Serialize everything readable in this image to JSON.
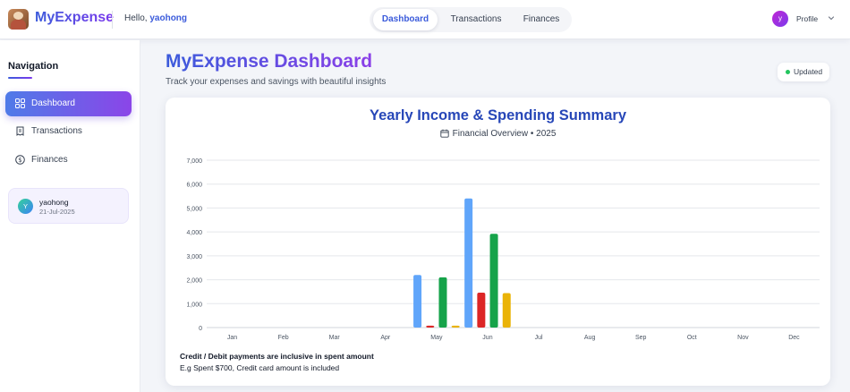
{
  "header": {
    "app_title": "MyExpense",
    "greeting": "Hello,",
    "username": "yaohong",
    "tabs": [
      "Dashboard",
      "Transactions",
      "Finances"
    ],
    "active_tab": "Dashboard",
    "profile_initial": "y",
    "profile_label": "Profile"
  },
  "sidebar": {
    "title": "Navigation",
    "items": [
      {
        "label": "Dashboard",
        "icon": "grid-icon",
        "active": true
      },
      {
        "label": "Transactions",
        "icon": "receipt-icon",
        "active": false
      },
      {
        "label": "Finances",
        "icon": "dollar-circle-icon",
        "active": false
      }
    ],
    "user_card": {
      "initial": "Y",
      "name": "yaohong",
      "date": "21-Jul-2025"
    }
  },
  "main": {
    "title": "MyExpense Dashboard",
    "subtitle": "Track your expenses and savings with beautiful insights",
    "status": "Updated"
  },
  "chart_data": {
    "type": "bar",
    "title": "Yearly Income & Spending Summary",
    "subtitle": "Financial Overview • 2025",
    "categories": [
      "Jan",
      "Feb",
      "Mar",
      "Apr",
      "May",
      "Jun",
      "Jul",
      "Aug",
      "Sep",
      "Oct",
      "Nov",
      "Dec"
    ],
    "ylim": [
      0,
      7000
    ],
    "yticks": [
      "0",
      "1,000",
      "2,000",
      "3,000",
      "4,000",
      "5,000",
      "6,000",
      "7,000"
    ],
    "grid": true,
    "series": [
      {
        "color": "#60a5fa",
        "values": [
          0,
          0,
          0,
          0,
          2200,
          5400,
          0,
          0,
          0,
          0,
          0,
          0
        ]
      },
      {
        "color": "#dc2626",
        "values": [
          0,
          0,
          0,
          0,
          80,
          1460,
          0,
          0,
          0,
          0,
          0,
          0
        ]
      },
      {
        "color": "#16a34a",
        "values": [
          0,
          0,
          0,
          0,
          2100,
          3920,
          0,
          0,
          0,
          0,
          0,
          0
        ]
      },
      {
        "color": "#eab308",
        "values": [
          0,
          0,
          0,
          0,
          80,
          1440,
          0,
          0,
          0,
          0,
          0,
          0
        ]
      }
    ]
  },
  "notes": {
    "line1": "Credit / Debit payments are inclusive in spent amount",
    "line2": "E.g Spent $700, Credit card amount is included"
  }
}
